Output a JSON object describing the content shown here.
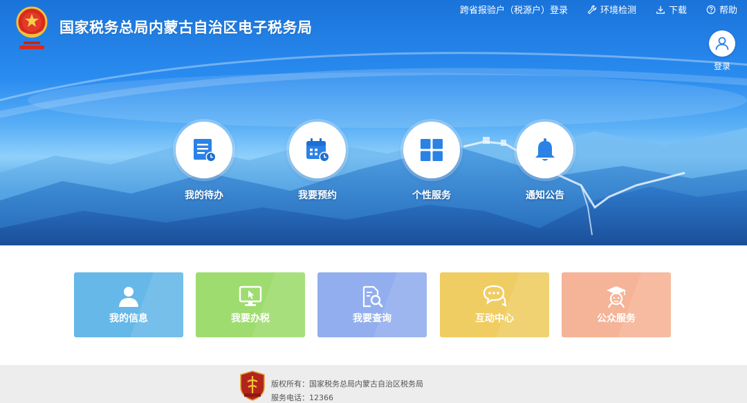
{
  "header": {
    "title": "国家税务总局内蒙古自治区电子税务局",
    "top_nav": [
      {
        "label": "跨省报验户（税源户）登录",
        "icon": "none"
      },
      {
        "label": "环境检测",
        "icon": "wrench-icon"
      },
      {
        "label": "下载",
        "icon": "download-icon"
      },
      {
        "label": "帮助",
        "icon": "help-icon"
      }
    ],
    "login_label": "登录"
  },
  "hero_items": [
    {
      "label": "我的待办",
      "icon": "todo-document-icon"
    },
    {
      "label": "我要预约",
      "icon": "calendar-clock-icon"
    },
    {
      "label": "个性服务",
      "icon": "grid-icon"
    },
    {
      "label": "通知公告",
      "icon": "bell-icon"
    }
  ],
  "tiles": [
    {
      "label": "我的信息",
      "icon": "user-icon",
      "color": "#66b8e8"
    },
    {
      "label": "我要办税",
      "icon": "monitor-cursor-icon",
      "color": "#9edc6f"
    },
    {
      "label": "我要查询",
      "icon": "document-search-icon",
      "color": "#92aeee"
    },
    {
      "label": "互动中心",
      "icon": "chat-bubbles-icon",
      "color": "#f0cd63"
    },
    {
      "label": "公众服务",
      "icon": "graduate-icon",
      "color": "#f5b497"
    }
  ],
  "footer": {
    "copyright": "版权所有：国家税务总局内蒙古自治区税务局",
    "phone": "服务电话：12366"
  },
  "colors": {
    "accent": "#1a73d9",
    "icon_blue": "#2a82e6",
    "footer_bg": "#ededed"
  }
}
